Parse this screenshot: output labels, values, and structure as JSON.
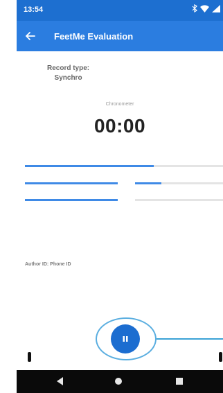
{
  "status_bar": {
    "time": "13:54",
    "icons": [
      "bluetooth-icon",
      "wifi-icon",
      "signal-icon"
    ]
  },
  "app_bar": {
    "title": "FeetMe Evaluation",
    "back_icon": "arrow-left-icon"
  },
  "record": {
    "label": "Record type:",
    "value": "Synchro"
  },
  "chronometer": {
    "label": "Chronometer",
    "value": "00:00"
  },
  "progress_bars": [
    {
      "name": "progress-row1",
      "fill": 0.65
    },
    {
      "name": "progress-row2-left",
      "fill": 1.0
    },
    {
      "name": "progress-row2-right",
      "fill": 0.3
    },
    {
      "name": "progress-row3-left",
      "fill": 1.0
    },
    {
      "name": "progress-row3-right",
      "fill": 0.0
    }
  ],
  "author": {
    "text": "Author ID: Phone ID"
  },
  "pause_button": {
    "icon": "pause-icon"
  },
  "nav_bar": {
    "icons": [
      "nav-back-icon",
      "nav-home-icon",
      "nav-recents-icon"
    ]
  },
  "colors": {
    "status_bar": "#1d6fd0",
    "app_bar": "#2b7de0",
    "accent": "#1c6dd0",
    "bar_fill": "#3f8ae6",
    "bar_track": "#e4e4e4"
  }
}
